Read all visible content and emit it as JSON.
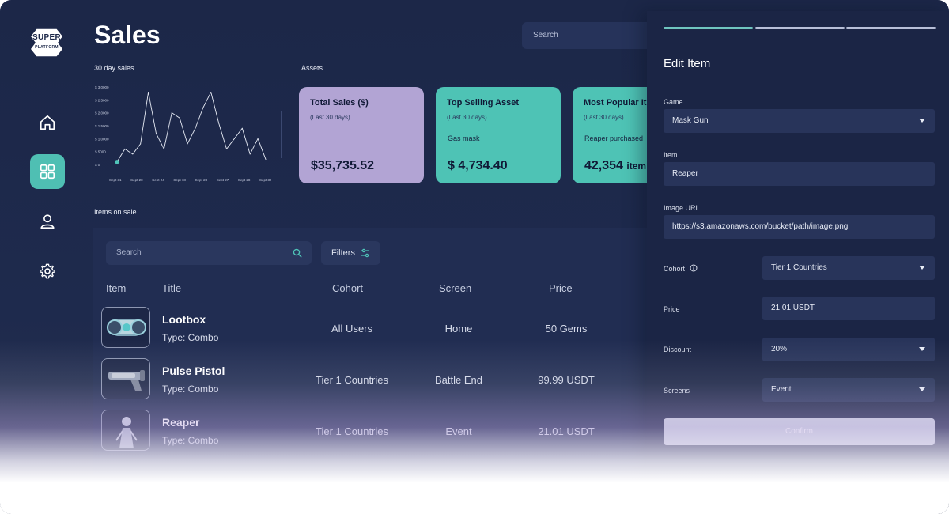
{
  "app": {
    "logo_line1": "SUPER",
    "logo_line2": "PLATFORM"
  },
  "header": {
    "title": "Sales",
    "search_placeholder": "Search"
  },
  "sidebar": {
    "items": [
      {
        "icon": "home-icon"
      },
      {
        "icon": "grid-icon",
        "active": true
      },
      {
        "icon": "user-icon"
      },
      {
        "icon": "gear-icon"
      }
    ]
  },
  "chart_section": {
    "label": "30 day sales"
  },
  "chart_data": {
    "type": "line",
    "title": "30 day sales",
    "y_tick_labels": [
      "$ 3.0000",
      "$ 2.5000",
      "$ 2.0000",
      "$ 1.5000",
      "$ 1.0000",
      "$ 5000",
      "$ 0"
    ],
    "x_tick_labels": [
      "Sept 31",
      "Sept 20",
      "Sept 24",
      "Sept 18",
      "Sept 28",
      "Sept 27",
      "Sept 28",
      "Sept 32"
    ],
    "ylim": [
      0,
      30000
    ],
    "series": [
      {
        "values": [
          1000,
          6000,
          4000,
          8000,
          28000,
          12000,
          6000,
          20000,
          18000,
          8000,
          14000,
          22000,
          28000,
          16000,
          6000,
          10000,
          14000,
          4000,
          10000,
          2000
        ]
      }
    ],
    "grid": false
  },
  "assets": {
    "label": "Assets",
    "cards": [
      {
        "title": "Total Sales ($)",
        "subtitle": "(Last 30 days)",
        "detail": "",
        "value": "$35,735.52",
        "color": "#b2a4d4"
      },
      {
        "title": "Top Selling Asset",
        "subtitle": "(Last 30 days)",
        "detail": "Gas mask",
        "value": "$ 4,734.40",
        "color": "#4ec3b5"
      },
      {
        "title": "Most Popular It",
        "subtitle": "(Last 30 days)",
        "detail": "Reaper purchased",
        "value": "42,354",
        "unit": "item",
        "color": "#4ec3b5"
      }
    ]
  },
  "items_section": {
    "label": "Items on sale",
    "search_placeholder": "Search",
    "filters_label": "Filters",
    "columns": [
      "Item",
      "Title",
      "Cohort",
      "Screen",
      "Price"
    ],
    "rows": [
      {
        "name": "Lootbox",
        "type": "Type: Combo",
        "cohort": "All Users",
        "screen": "Home",
        "price": "50 Gems"
      },
      {
        "name": "Pulse Pistol",
        "type": "Type: Combo",
        "cohort": "Tier 1 Countries",
        "screen": "Battle End",
        "price": "99.99 USDT"
      },
      {
        "name": "Reaper",
        "type": "Type: Combo",
        "cohort": "Tier 1 Countries",
        "screen": "Event",
        "price": "21.01 USDT"
      }
    ]
  },
  "edit_panel": {
    "title": "Edit Item",
    "progress_colors": [
      "#6fc5bf",
      "#b8bfd8",
      "#b8bfd8"
    ],
    "game_label": "Game",
    "game_value": "Mask Gun",
    "item_label": "Item",
    "item_value": "Reaper",
    "image_url_label": "Image URL",
    "image_url_value": "https://s3.amazonaws.com/bucket/path/image.png",
    "cohort_label": "Cohort",
    "cohort_value": "Tier 1 Countries",
    "price_label": "Price",
    "price_value": "21.01 USDT",
    "discount_label": "Discount",
    "discount_value": "20%",
    "screens_label": "Screens",
    "screens_value": "Event",
    "confirm_label": "Confirm"
  }
}
